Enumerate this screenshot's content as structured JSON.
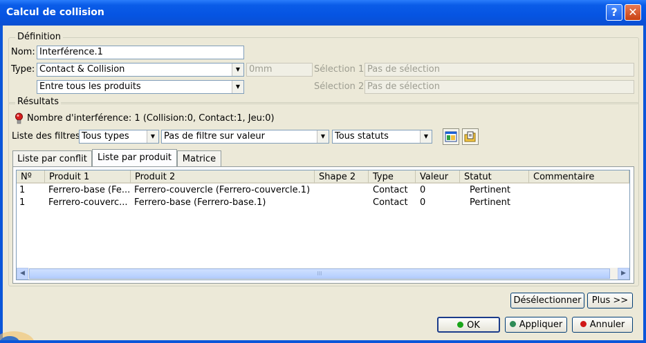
{
  "window": {
    "title": "Calcul de collision",
    "help_label": "?",
    "close_label": "✕"
  },
  "definition": {
    "group_label": "Définition",
    "nom_label": "Nom:",
    "nom_value": "Interférence.1",
    "type_label": "Type:",
    "type_value": "Contact & Collision",
    "clearance_value": "0mm",
    "scope_value": "Entre tous les produits",
    "selection1_label": "Sélection 1:",
    "selection1_value": "Pas de sélection",
    "selection2_label": "Sélection 2:",
    "selection2_value": "Pas de sélection"
  },
  "results": {
    "group_label": "Résultats",
    "summary": "Nombre d'interférence: 1 (Collision:0, Contact:1, Jeu:0)",
    "filters_label": "Liste des filtres:",
    "filter_type": "Tous types",
    "filter_value": "Pas de filtre sur valeur",
    "filter_status": "Tous statuts",
    "tabs": [
      {
        "label": "Liste par conflit"
      },
      {
        "label": "Liste par produit"
      },
      {
        "label": "Matrice"
      }
    ],
    "columns": [
      "Nº",
      "Produit 1",
      "Produit 2",
      "Shape 2",
      "Type",
      "Valeur",
      "Statut",
      "Commentaire"
    ],
    "rows": [
      [
        "1",
        "Ferrero-base (Fe...",
        "Ferrero-couvercle (Ferrero-couvercle.1)",
        "",
        "Contact",
        "0",
        "Pertinent",
        ""
      ],
      [
        "1",
        "Ferrero-couverc...",
        "Ferrero-base (Ferrero-base.1)",
        "",
        "Contact",
        "0",
        "Pertinent",
        ""
      ]
    ],
    "scroll_thumb_label": "III"
  },
  "buttons": {
    "deselect": "Désélectionner",
    "more": "Plus >>",
    "ok": "OK",
    "apply": "Appliquer",
    "cancel": "Annuler"
  },
  "colors": {
    "titlebar": "#0a5ce8",
    "dialog_bg": "#ece9d8",
    "ok_dot": "#1aa51a",
    "apply_dot": "#2e8b57",
    "cancel_dot": "#d01818"
  },
  "icons": {
    "interference": "red-bulb-icon",
    "tb1": "window-table-icon",
    "tb2": "folder-export-icon"
  }
}
